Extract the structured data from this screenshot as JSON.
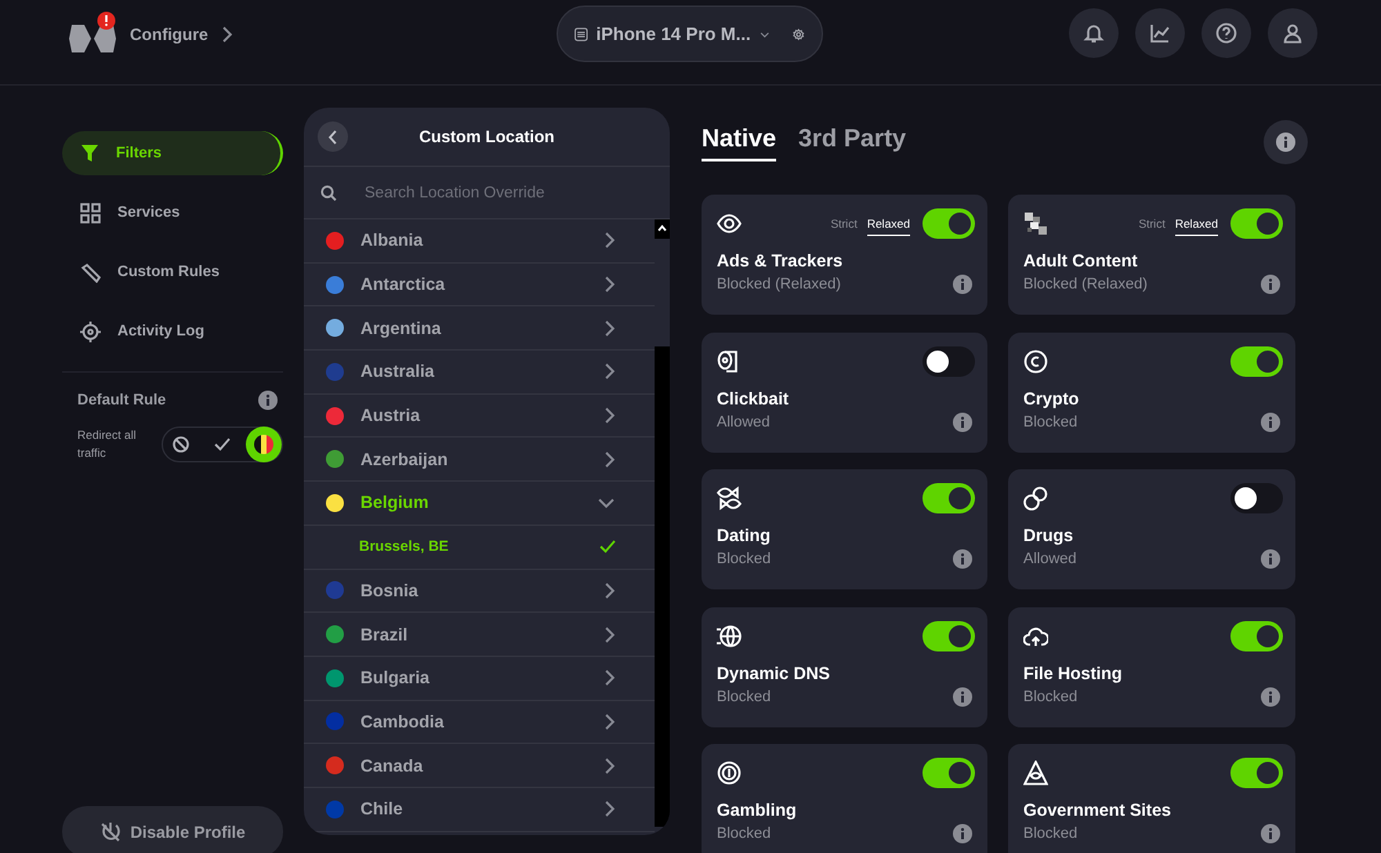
{
  "header": {
    "section": "Configure",
    "device": "iPhone 14 Pro M...",
    "alert": true
  },
  "sidebar": {
    "items": [
      {
        "label": "Filters",
        "kind": "filter",
        "selected": true
      },
      {
        "label": "Services",
        "kind": "grid",
        "selected": false
      },
      {
        "label": "Custom Rules",
        "kind": "tool",
        "selected": false
      },
      {
        "label": "Activity Log",
        "kind": "target",
        "selected": false
      }
    ]
  },
  "default_rule": {
    "title": "Default Rule",
    "label": "Redirect all traffic",
    "options": [
      {
        "kind": "block",
        "selected": false
      },
      {
        "kind": "allow",
        "selected": false
      },
      {
        "kind": "redirect",
        "selected": true
      }
    ]
  },
  "disable_button": "Disable Profile",
  "location_panel": {
    "title": "Custom Location",
    "search": {
      "placeholder": "Search Location Override"
    },
    "countries": [
      {
        "name": "Albania",
        "color": "#e41e20",
        "expanded": false
      },
      {
        "name": "Antarctica",
        "color": "#3a7dd8",
        "expanded": false
      },
      {
        "name": "Argentina",
        "color": "#74acdf",
        "expanded": false
      },
      {
        "name": "Australia",
        "color": "#1f3c8f",
        "expanded": false
      },
      {
        "name": "Austria",
        "color": "#ed2939",
        "expanded": false
      },
      {
        "name": "Azerbaijan",
        "color": "#3f9c35",
        "expanded": false
      },
      {
        "name": "Belgium",
        "color": "#fae042",
        "expanded": true,
        "children": [
          {
            "name": "Brussels, BE",
            "selected": true
          }
        ]
      },
      {
        "name": "Bosnia",
        "color": "#1f3a93",
        "expanded": false
      },
      {
        "name": "Brazil",
        "color": "#229e45",
        "expanded": false
      },
      {
        "name": "Bulgaria",
        "color": "#00966e",
        "expanded": false
      },
      {
        "name": "Cambodia",
        "color": "#032ea1",
        "expanded": false
      },
      {
        "name": "Canada",
        "color": "#d52b1e",
        "expanded": false
      },
      {
        "name": "Chile",
        "color": "#0039a6",
        "expanded": false
      }
    ]
  },
  "tabs": [
    {
      "label": "Native",
      "selected": true
    },
    {
      "label": "3rd Party",
      "selected": false
    }
  ],
  "filters": [
    {
      "name": "Ads & Trackers",
      "status": "Blocked (Relaxed)",
      "kind": "eye",
      "on": true,
      "modes": [
        {
          "label": "Strict",
          "selected": false
        },
        {
          "label": "Relaxed",
          "selected": true
        }
      ]
    },
    {
      "name": "Adult Content",
      "status": "Blocked (Relaxed)",
      "kind": "pixels",
      "on": true,
      "modes": [
        {
          "label": "Strict",
          "selected": false
        },
        {
          "label": "Relaxed",
          "selected": true
        }
      ]
    },
    {
      "name": "Clickbait",
      "status": "Allowed",
      "kind": "roll",
      "on": false
    },
    {
      "name": "Crypto",
      "status": "Blocked",
      "kind": "coin",
      "on": true
    },
    {
      "name": "Dating",
      "status": "Blocked",
      "kind": "fish",
      "on": true
    },
    {
      "name": "Drugs",
      "status": "Allowed",
      "kind": "pills",
      "on": false
    },
    {
      "name": "Dynamic DNS",
      "status": "Blocked",
      "kind": "globe",
      "on": true
    },
    {
      "name": "File Hosting",
      "status": "Blocked",
      "kind": "cloud",
      "on": true
    },
    {
      "name": "Gambling",
      "status": "Blocked",
      "kind": "chip",
      "on": true
    },
    {
      "name": "Government Sites",
      "status": "Blocked",
      "kind": "pyramid",
      "on": true
    }
  ]
}
